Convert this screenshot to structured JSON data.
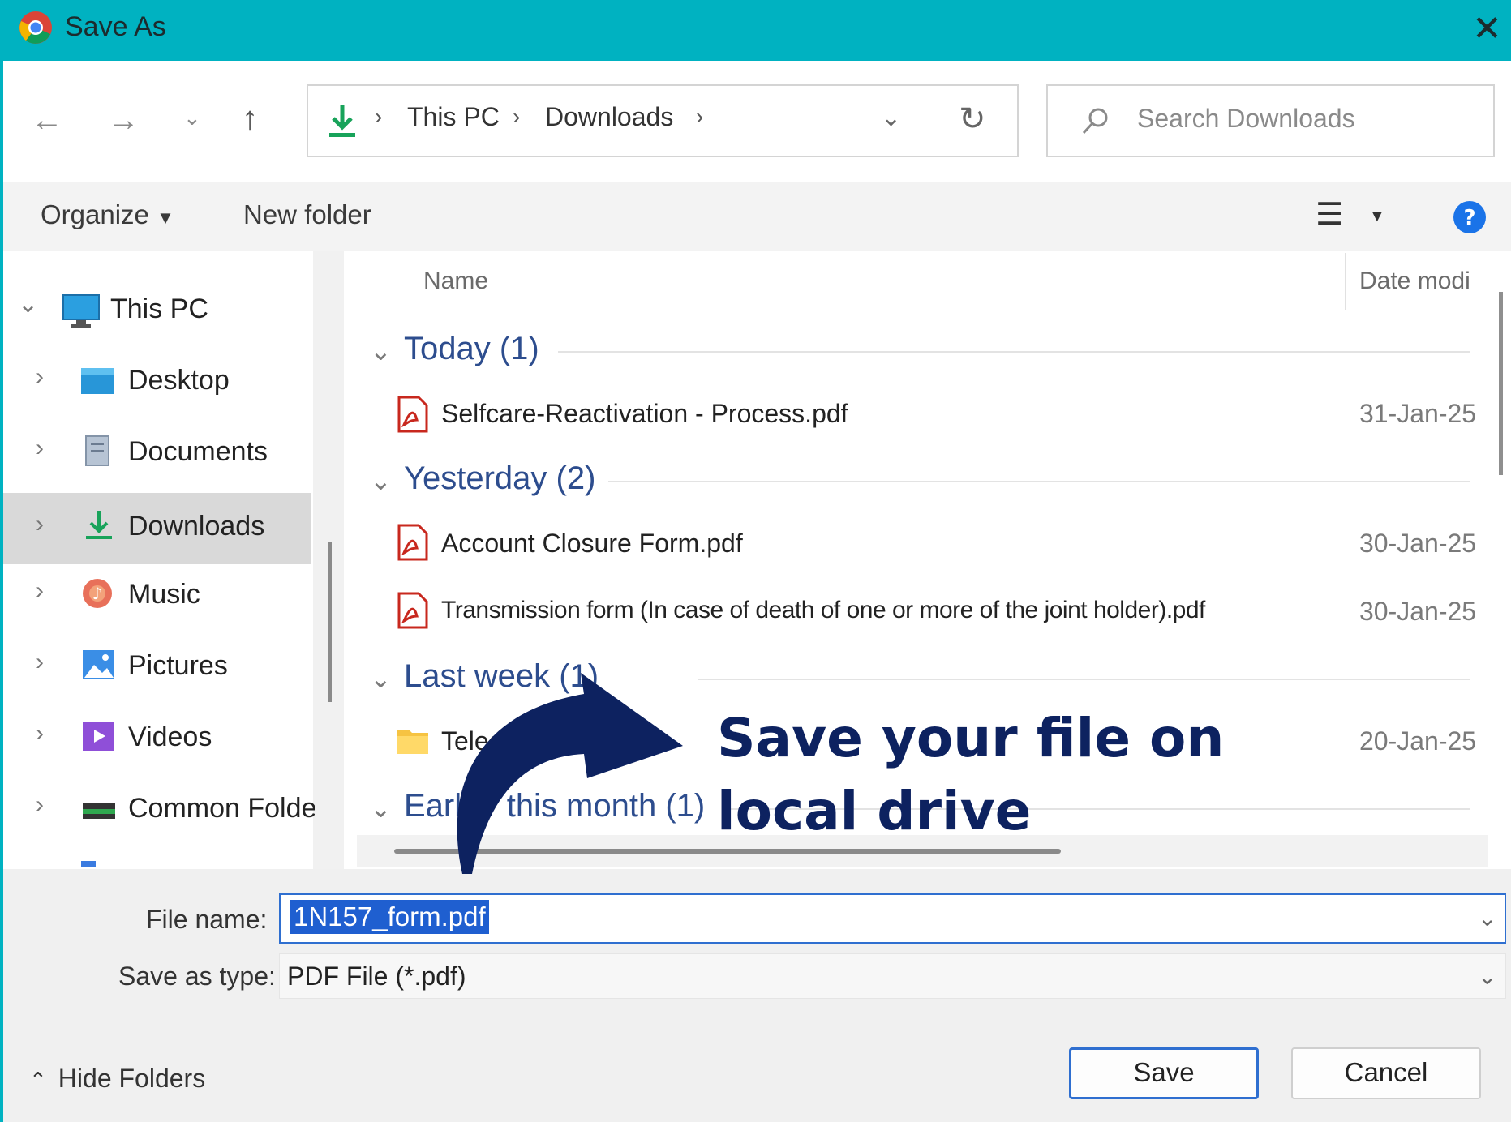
{
  "window": {
    "title": "Save As",
    "app_icon": "chrome-icon",
    "close_icon": "close-icon"
  },
  "nav": {
    "back_icon": "back-arrow-icon",
    "forward_icon": "forward-arrow-icon",
    "recent_icon": "chevron-down-icon",
    "up_icon": "up-arrow-icon",
    "breadcrumb": [
      "This PC",
      "Downloads"
    ],
    "refresh_icon": "refresh-icon",
    "search_placeholder": "Search Downloads"
  },
  "toolbar": {
    "organize_label": "Organize",
    "new_folder_label": "New folder",
    "view_icon": "view-list-icon",
    "help_icon": "help-icon"
  },
  "sidebar": {
    "root": "This PC",
    "items": [
      {
        "label": "Desktop",
        "icon": "desktop-folder-icon"
      },
      {
        "label": "Documents",
        "icon": "documents-folder-icon"
      },
      {
        "label": "Downloads",
        "icon": "downloads-folder-icon",
        "selected": true
      },
      {
        "label": "Music",
        "icon": "music-folder-icon"
      },
      {
        "label": "Pictures",
        "icon": "pictures-folder-icon"
      },
      {
        "label": "Videos",
        "icon": "videos-folder-icon"
      },
      {
        "label": "Common Folde",
        "icon": "drive-icon"
      }
    ]
  },
  "list": {
    "columns": {
      "name": "Name",
      "date": "Date modi"
    },
    "groups": [
      {
        "label": "Today (1)",
        "files": [
          {
            "name": "Selfcare-Reactivation - Process.pdf",
            "date": "31-Jan-25 :",
            "icon": "pdf-icon"
          }
        ]
      },
      {
        "label": "Yesterday (2)",
        "files": [
          {
            "name": "Account Closure Form.pdf",
            "date": "30-Jan-25 1",
            "icon": "pdf-icon"
          },
          {
            "name": "Transmission form (In case of death of one or  more of the joint holder).pdf",
            "date": "30-Jan-25",
            "icon": "pdf-icon"
          }
        ]
      },
      {
        "label": "Last week (1)",
        "files": [
          {
            "name": "Telegram Desk",
            "date": "20-Jan-25 1",
            "icon": "folder-icon"
          }
        ]
      },
      {
        "label": "Earlier this month (1)",
        "files": []
      }
    ]
  },
  "bottom": {
    "file_name_label": "File name:",
    "file_name_value": "1N157_form.pdf",
    "save_type_label": "Save as type:",
    "save_type_value": "PDF File (*.pdf)",
    "hide_folders_label": "Hide Folders",
    "save_label": "Save",
    "cancel_label": "Cancel"
  },
  "overlay": {
    "callout": "Save your file on local drive"
  },
  "colors": {
    "titlebar": "#00b2c1",
    "accent": "#2f6fd0",
    "callout": "#0d2260",
    "group_header": "#2d4d8e"
  }
}
